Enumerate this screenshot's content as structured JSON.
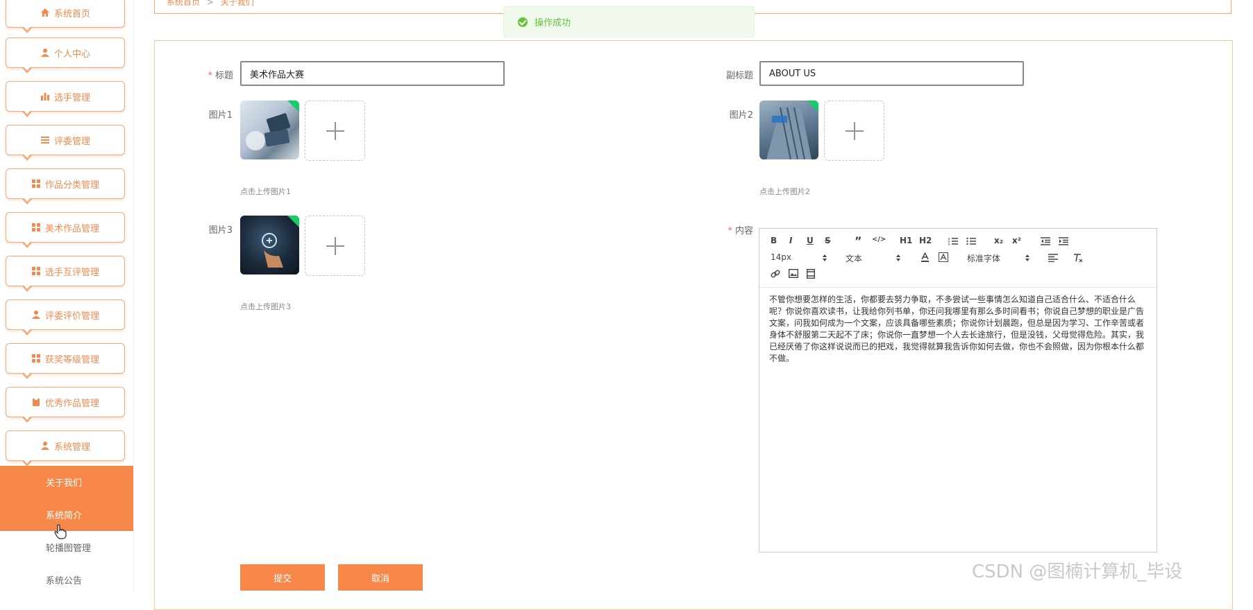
{
  "sidebar": {
    "items": [
      {
        "label": "系统首页",
        "icon": "home-icon"
      },
      {
        "label": "个人中心",
        "icon": "user-icon"
      },
      {
        "label": "选手管理",
        "icon": "bar-chart-icon"
      },
      {
        "label": "评委管理",
        "icon": "list-icon"
      },
      {
        "label": "作品分类管理",
        "icon": "grid-icon"
      },
      {
        "label": "美术作品管理",
        "icon": "grid-icon"
      },
      {
        "label": "选手互评管理",
        "icon": "grid-icon"
      },
      {
        "label": "评委评价管理",
        "icon": "user-icon"
      },
      {
        "label": "获奖等级管理",
        "icon": "grid-icon"
      },
      {
        "label": "优秀作品管理",
        "icon": "clipboard-icon"
      },
      {
        "label": "系统管理",
        "icon": "user-icon"
      }
    ],
    "submenu": [
      {
        "label": "关于我们",
        "active": true
      },
      {
        "label": "系统简介",
        "active": true
      },
      {
        "label": "轮播图管理",
        "active": false
      },
      {
        "label": "系统公告",
        "active": false
      }
    ]
  },
  "breadcrumb": {
    "home": "系统首页",
    "separator": ">",
    "current": "关于我们"
  },
  "toast": {
    "message": "操作成功"
  },
  "form": {
    "title_label": "标题",
    "title_value": "美术作品大赛",
    "subtitle_label": "副标题",
    "subtitle_value": "ABOUT US",
    "pic1_label": "图片1",
    "pic1_hint": "点击上传图片1",
    "pic2_label": "图片2",
    "pic2_hint": "点击上传图片2",
    "pic3_label": "图片3",
    "pic3_hint": "点击上传图片3",
    "content_label": "内容"
  },
  "editor": {
    "toolbar_row1": [
      "B",
      "I",
      "U",
      "S",
      "”",
      "</>",
      "H1",
      "H2",
      "ol",
      "ul",
      "x₂",
      "x²",
      "outdent",
      "indent"
    ],
    "font_size": "14px",
    "format": "文本",
    "font_family": "标准字体",
    "content": "不管你想要怎样的生活，你都要去努力争取，不多尝试一些事情怎么知道自己适合什么、不适合什么呢？你说你喜欢读书，让我给你列书单，你还问我哪里有那么多时间看书；你说自己梦想的职业是广告文案，问我如何成为一个文案，应该具备哪些素质；你说你计划晨跑，但总是因为学习、工作辛苦或者身体不舒服第二天起不了床；你说你一直梦想一个人去长途旅行，但是没钱，父母觉得危险。其实，我已经厌倦了你这样说说而已的把戏，我觉得就算我告诉你如何去做，你也不会照做，因为你根本什么都不做。"
  },
  "buttons": {
    "submit": "提交",
    "cancel": "取消"
  },
  "watermark": "CSDN @图楠计算机_毕设",
  "colors": {
    "accent": "#f7884a",
    "success": "#67c23a"
  }
}
